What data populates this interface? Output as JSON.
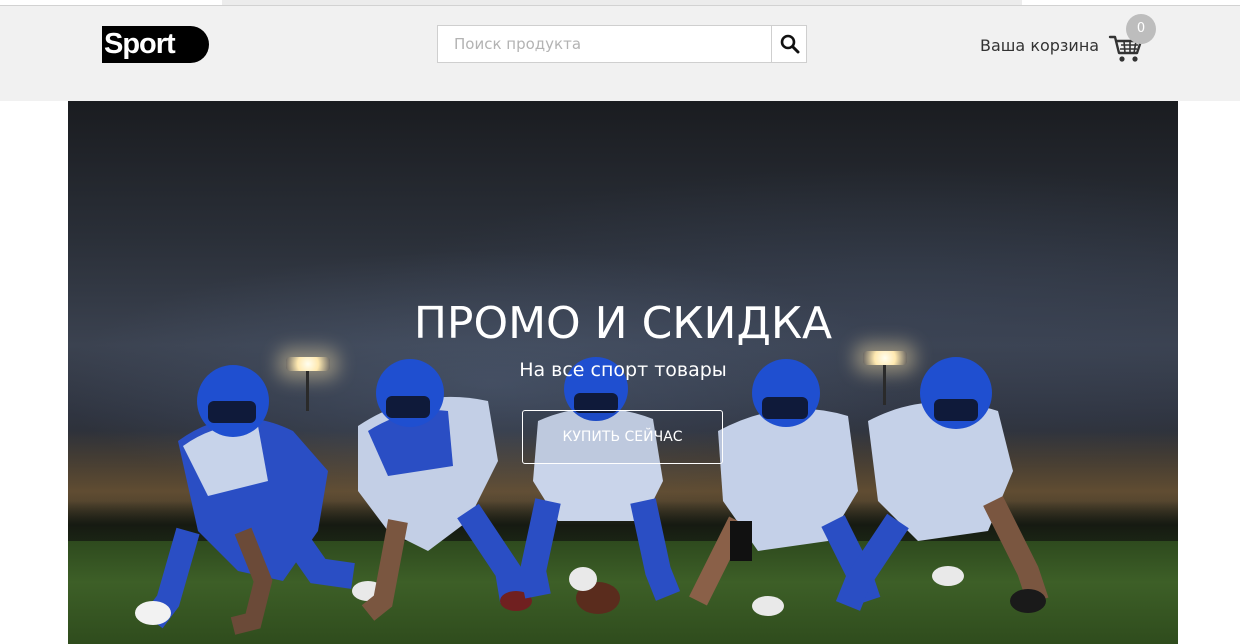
{
  "header": {
    "logo_text": "Sport",
    "search": {
      "placeholder": "Поиск продукта",
      "value": ""
    },
    "cart": {
      "label": "Ваша корзина",
      "count": "0"
    }
  },
  "hero": {
    "title": "ПРОМО И СКИДКА",
    "subtitle": "На все спорт товары",
    "cta_label": "КУПИТЬ СЕЙЧАС"
  },
  "colors": {
    "header_bg": "#f1f1f1",
    "logo_bg": "#000000",
    "badge_bg": "#bdbdbd",
    "jersey_blue": "#1f4fc7"
  },
  "icons": [
    "search-icon",
    "cart-icon"
  ]
}
